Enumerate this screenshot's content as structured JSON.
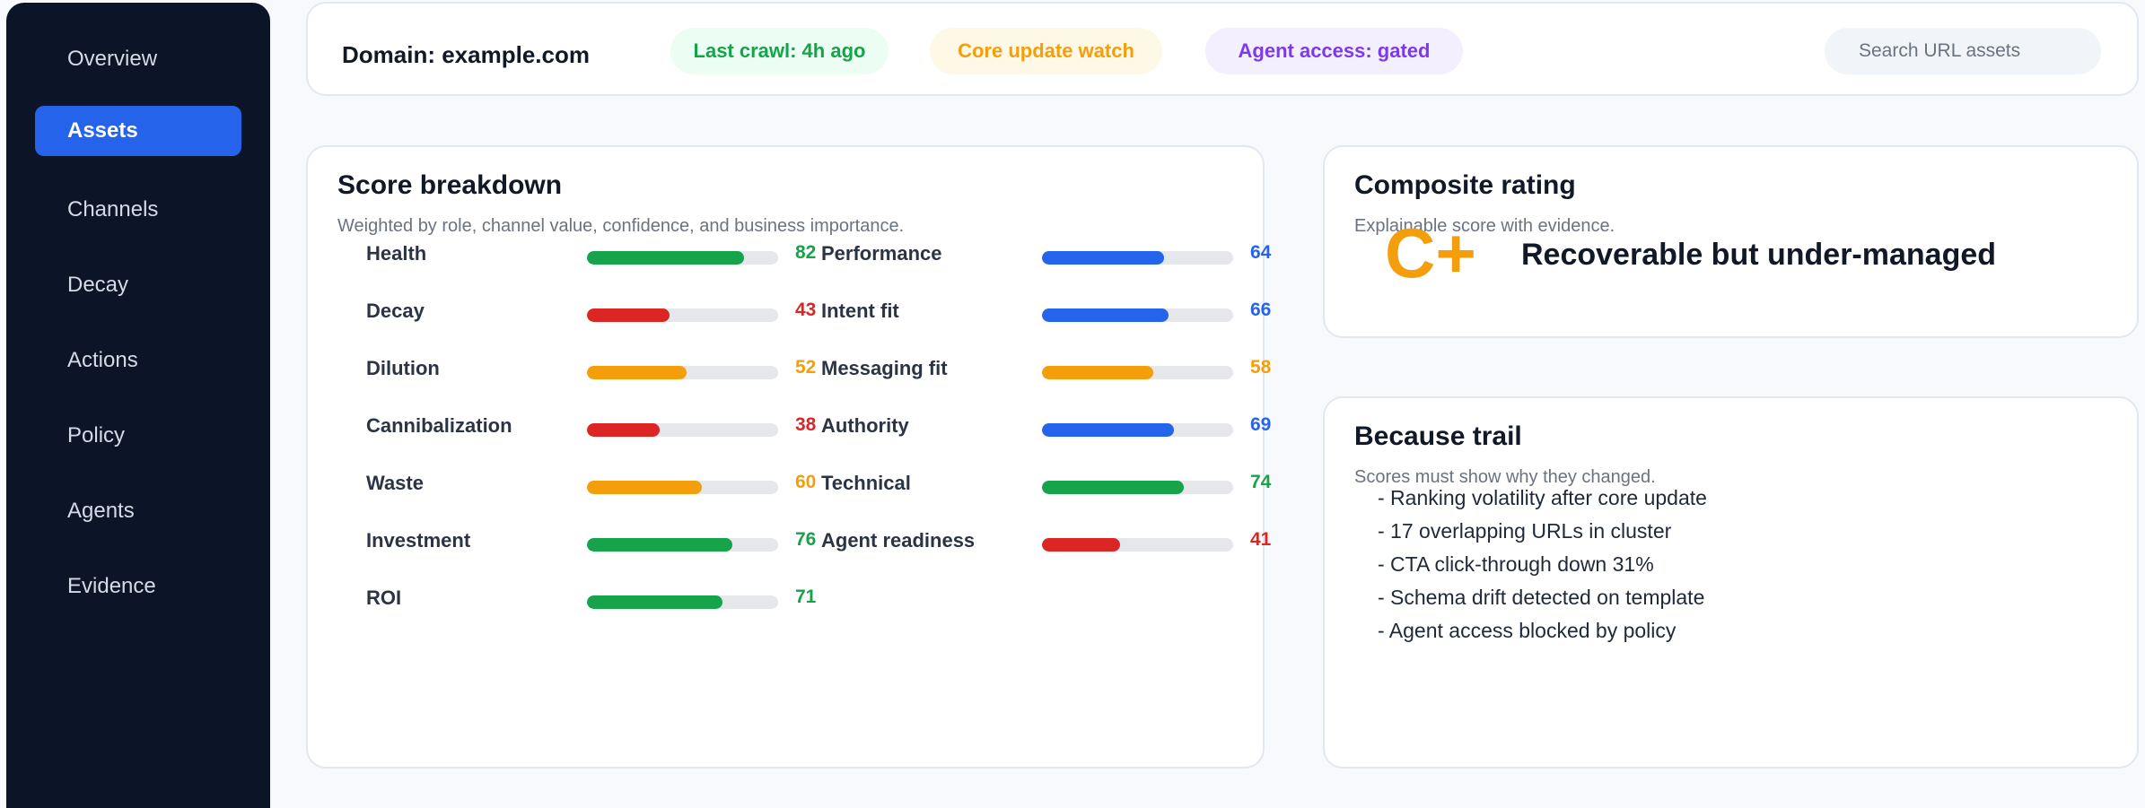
{
  "sidebar": {
    "items": [
      {
        "label": "Overview",
        "active": false
      },
      {
        "label": "Assets",
        "active": true
      },
      {
        "label": "Channels",
        "active": false
      },
      {
        "label": "Decay",
        "active": false
      },
      {
        "label": "Actions",
        "active": false
      },
      {
        "label": "Policy",
        "active": false
      },
      {
        "label": "Agents",
        "active": false
      },
      {
        "label": "Evidence",
        "active": false
      }
    ]
  },
  "topbar": {
    "domain": "Domain: example.com",
    "badges": [
      {
        "label": "Last crawl: 4h ago",
        "color": "#16a34a",
        "bg": "#ecfdf3"
      },
      {
        "label": "Core update watch",
        "color": "#f59e0b",
        "bg": "#fef8e6"
      },
      {
        "label": "Agent access: gated",
        "color": "#7c3aed",
        "bg": "#f3effe"
      }
    ],
    "search_placeholder": "Search URL assets"
  },
  "score_breakdown": {
    "title": "Score breakdown",
    "subtitle": "Weighted by role, channel value, confidence, and business importance.",
    "left": [
      {
        "label": "Health",
        "value": 82,
        "color": "#16a34a"
      },
      {
        "label": "Decay",
        "value": 43,
        "color": "#dc2626"
      },
      {
        "label": "Dilution",
        "value": 52,
        "color": "#f59e0b"
      },
      {
        "label": "Cannibalization",
        "value": 38,
        "color": "#dc2626"
      },
      {
        "label": "Waste",
        "value": 60,
        "color": "#f59e0b"
      },
      {
        "label": "Investment",
        "value": 76,
        "color": "#16a34a"
      },
      {
        "label": "ROI",
        "value": 71,
        "color": "#16a34a"
      }
    ],
    "right": [
      {
        "label": "Performance",
        "value": 64,
        "color": "#2563eb"
      },
      {
        "label": "Intent fit",
        "value": 66,
        "color": "#2563eb"
      },
      {
        "label": "Messaging fit",
        "value": 58,
        "color": "#f59e0b"
      },
      {
        "label": "Authority",
        "value": 69,
        "color": "#2563eb"
      },
      {
        "label": "Technical",
        "value": 74,
        "color": "#16a34a"
      },
      {
        "label": "Agent readiness",
        "value": 41,
        "color": "#dc2626"
      }
    ]
  },
  "composite": {
    "title": "Composite rating",
    "subtitle": "Explainable score with evidence.",
    "grade": "C+",
    "description": "Recoverable but under-managed"
  },
  "trail": {
    "title": "Because trail",
    "subtitle": "Scores must show why they changed.",
    "items": [
      "- Ranking volatility after core update",
      "- 17 overlapping URLs in cluster",
      "- CTA click-through down 31%",
      "- Schema drift detected on template",
      "- Agent access blocked by policy"
    ]
  }
}
